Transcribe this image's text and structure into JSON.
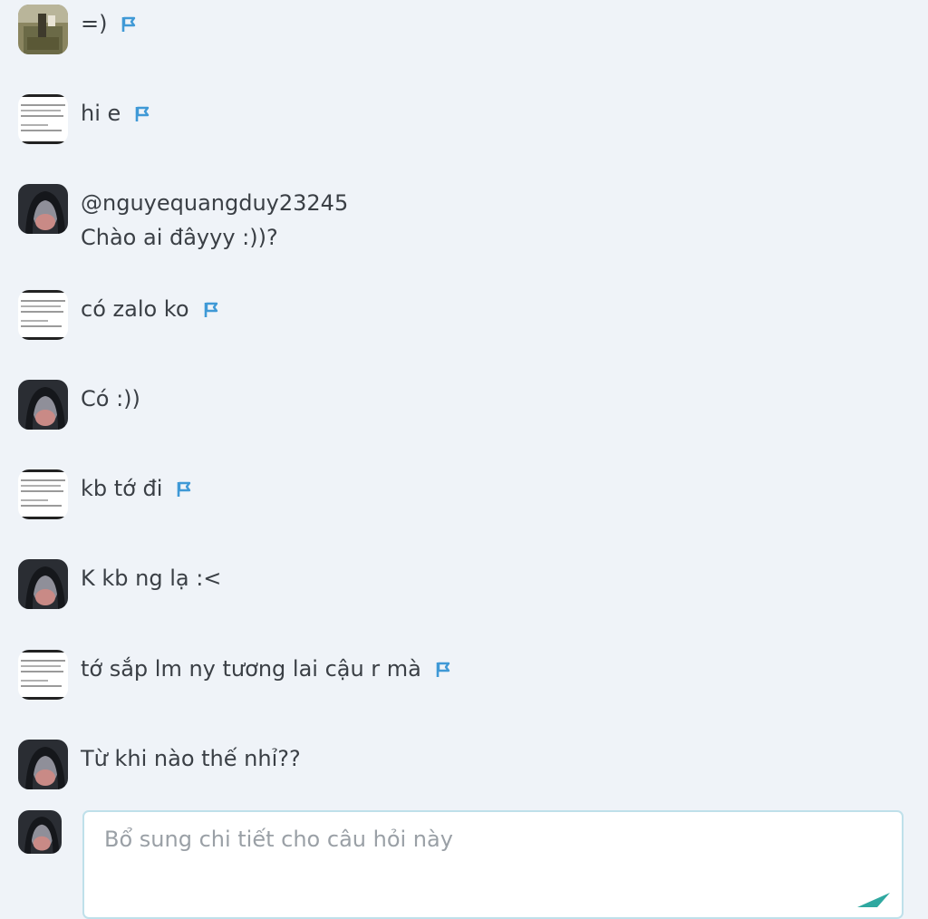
{
  "colors": {
    "background": "#eff3f8",
    "flag": "#3f99d6",
    "text": "#3a3f45",
    "composer_border": "#bfe0ea",
    "send": "#2fa8a0"
  },
  "messages": [
    {
      "avatar": "landscape-avatar",
      "text": "=)",
      "flag": true
    },
    {
      "avatar": "document-avatar",
      "text": "hi e",
      "flag": true
    },
    {
      "avatar": "girl-avatar",
      "mention": "@nguyequangduy23245",
      "text": "Chào ai đâyyy :))?",
      "flag": false
    },
    {
      "avatar": "document-avatar",
      "text": "có zalo ko",
      "flag": true
    },
    {
      "avatar": "girl-avatar",
      "text": "Có :))",
      "flag": false
    },
    {
      "avatar": "document-avatar",
      "text": "kb tớ đi",
      "flag": true
    },
    {
      "avatar": "girl-avatar",
      "text": "K kb ng lạ :<",
      "flag": false
    },
    {
      "avatar": "document-avatar",
      "text": "tớ sắp lm ny tương lai cậu r mà",
      "flag": true
    },
    {
      "avatar": "girl-avatar",
      "text": "Từ khi nào thế nhỉ??",
      "flag": false
    }
  ],
  "composer": {
    "placeholder": "Bổ sung chi tiết cho câu hỏi này",
    "value": ""
  }
}
